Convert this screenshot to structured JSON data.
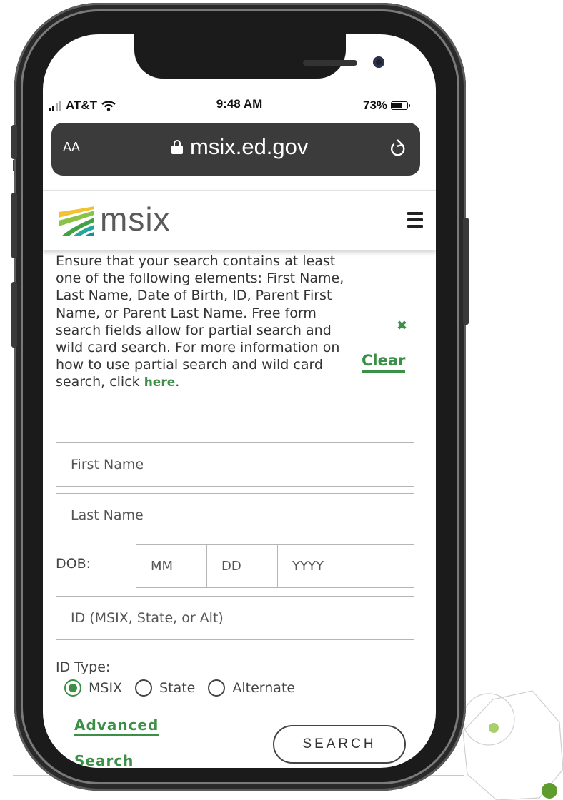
{
  "status_bar": {
    "carrier": "AT&T",
    "time": "9:48 AM",
    "battery_percent": "73%",
    "battery_level": 0.73
  },
  "browser": {
    "text_size_label": "AA",
    "url": "msix.ed.gov",
    "icons": [
      "lock-icon",
      "reload-icon"
    ]
  },
  "header": {
    "logo_text": "msix",
    "menu_icon": "hamburger-menu-icon"
  },
  "search_panel": {
    "info_text": "Ensure that your search contains at least one of the following elements: First Name, Last Name, Date of Birth, ID, Parent First Name, or Parent Last Name. Free form search fields allow for partial search and wild card search. For more information on how to use partial search and wild card search, click ",
    "info_link": "here",
    "info_end": ".",
    "dismiss_icon": "close-x-icon",
    "clear_label": "Clear",
    "first_name_placeholder": "First Name",
    "last_name_placeholder": "Last Name",
    "dob_label": "DOB:",
    "dob_month_placeholder": "MM",
    "dob_day_placeholder": "DD",
    "dob_year_placeholder": "YYYY",
    "id_placeholder": "ID (MSIX, State, or Alt)",
    "id_type_label": "ID Type:",
    "id_type_options": [
      {
        "label": "MSIX",
        "selected": true
      },
      {
        "label": "State",
        "selected": false
      },
      {
        "label": "Alternate",
        "selected": false
      }
    ],
    "advanced_line1": "Advanced",
    "advanced_line2": "Search",
    "search_button": "SEARCH"
  },
  "colors": {
    "accent_green": "#3b8f46",
    "url_bar": "#3b3b3b",
    "phone_frame": "#1b1b1b"
  }
}
